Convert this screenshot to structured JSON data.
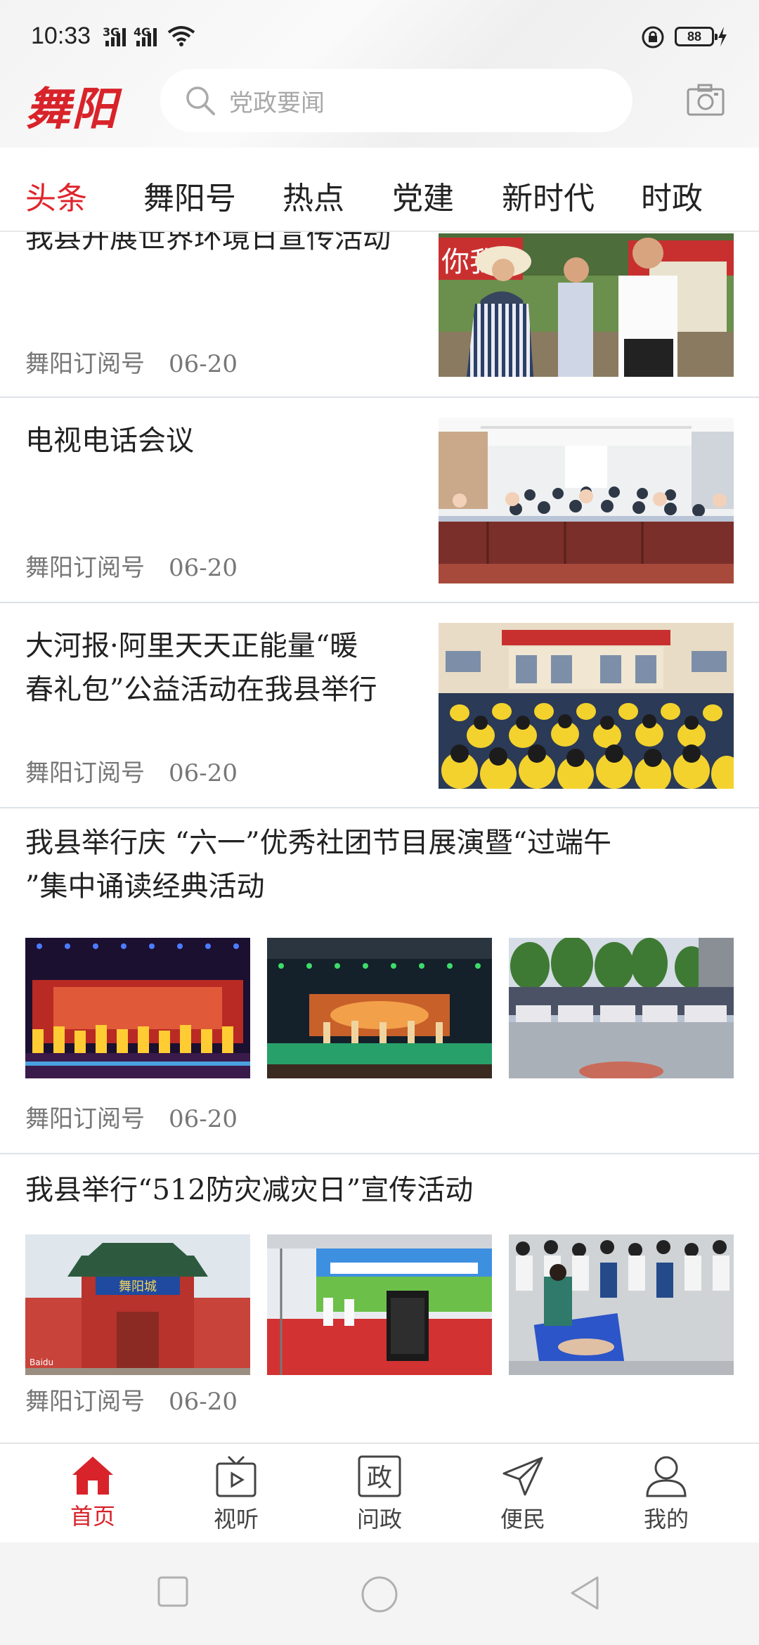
{
  "status": {
    "time": "10:33",
    "net1": "3G",
    "net2": "4G",
    "battery": "88"
  },
  "header": {
    "logo": "舞阳",
    "search_placeholder": "党政要闻"
  },
  "tabs": [
    "头条",
    "舞阳号",
    "热点",
    "党建",
    "新时代",
    "时政"
  ],
  "articles": [
    {
      "title": "我县开展世界环境日宣传活动",
      "source": "舞阳订阅号",
      "date": "06-20"
    },
    {
      "title": "电视电话会议",
      "source": "舞阳订阅号",
      "date": "06-20"
    },
    {
      "title_line1": "大河报·阿里天天正能量“暖",
      "title_line2": "春礼包”公益活动在我县举行",
      "source": "舞阳订阅号",
      "date": "06-20"
    },
    {
      "title_line1": "我县举行庆 “六一”优秀社团节目展演暨“过端午",
      "title_line2": "”集中诵读经典活动",
      "source": "舞阳订阅号",
      "date": "06-20"
    },
    {
      "title": "我县举行“512防灾减灾日”宣传活动",
      "source": "舞阳订阅号",
      "date": "06-20"
    }
  ],
  "image_text": {
    "banner_left": "你我",
    "gate_sign": "舞阳城",
    "watermark": "Baidu"
  },
  "bottom_nav": [
    {
      "label": "首页",
      "icon": "home-icon"
    },
    {
      "label": "视听",
      "icon": "tv-icon"
    },
    {
      "label": "问政",
      "icon": "zheng-icon",
      "glyph": "政"
    },
    {
      "label": "便民",
      "icon": "send-icon"
    },
    {
      "label": "我的",
      "icon": "person-icon"
    }
  ],
  "colors": {
    "accent": "#d8232a",
    "divider": "#dde3ea"
  }
}
